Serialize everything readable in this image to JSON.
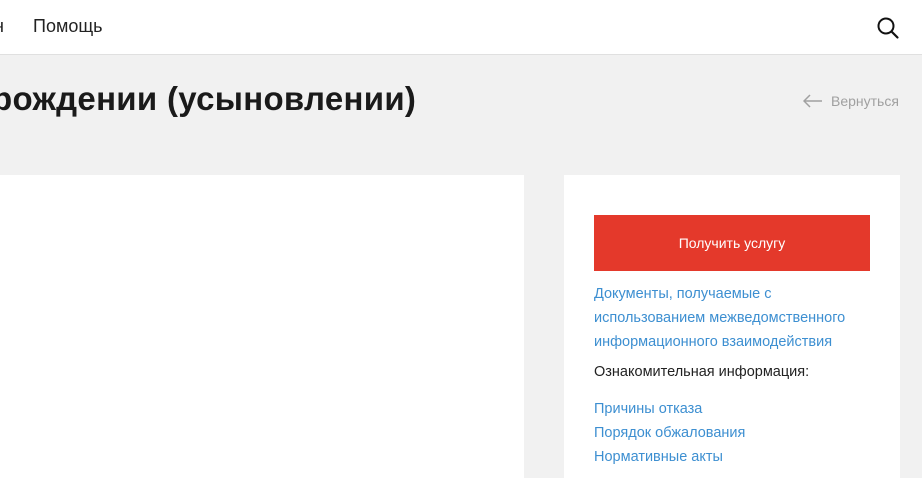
{
  "header": {
    "nav_partial": "н",
    "help_label": "Помощь",
    "search_icon": "search-icon"
  },
  "page": {
    "title": "рождении (усыновлении)",
    "back_label": "Вернуться",
    "back_icon": "arrow-left-icon"
  },
  "sidebar": {
    "cta_label": "Получить услугу",
    "documents_link": "Документы, получаемые с использованием межведомственного информационного взаимодействия",
    "info_label": "Ознакомительная информация:",
    "info_links": [
      "Причины отказа",
      "Порядок обжалования",
      "Нормативные акты"
    ]
  },
  "colors": {
    "accent": "#e4392b",
    "link": "#3d8fd1",
    "background": "#f1f1f1",
    "muted": "#a0a0a0"
  }
}
